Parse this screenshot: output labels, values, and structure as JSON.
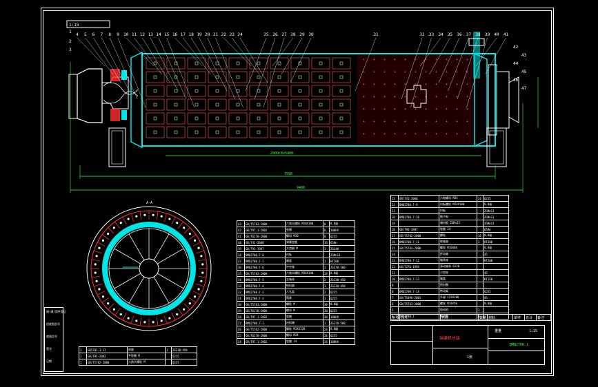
{
  "colors": {
    "background": "#000000",
    "line": "#ffffff",
    "shell": "#00e5e5",
    "hatch": "#ff3030",
    "dimension": "#40ff40",
    "leader": "#ffff40"
  },
  "icons": [
    "ball-mill-section-drawing",
    "end-view-cross-section"
  ],
  "title_box_label": "1:15",
  "view_label": "A-A",
  "balloon_numbers": [
    "1",
    "2",
    "3",
    "4",
    "5",
    "6",
    "7",
    "8",
    "9",
    "10",
    "11",
    "12",
    "13",
    "14",
    "15",
    "16",
    "17",
    "18",
    "19",
    "20",
    "21",
    "22",
    "23",
    "24",
    "25",
    "26",
    "27",
    "28",
    "29",
    "30",
    "31",
    "32",
    "33",
    "34",
    "35",
    "36",
    "37",
    "38",
    "39",
    "40",
    "41",
    "42",
    "43",
    "44",
    "45",
    "46",
    "47"
  ],
  "dimensions": {
    "overall": "9400",
    "span": "7590",
    "barrel": "2900/8x5400"
  },
  "parts_list_left": [
    {
      "no": "43",
      "code": "GB/T5783-2000",
      "name": "六角头螺栓 M20X180",
      "qty": "8",
      "mat": "8.8级"
    },
    {
      "no": "42",
      "code": "GB/T97.1-2002",
      "name": "垫圈",
      "qty": "8",
      "mat": "300HV"
    },
    {
      "no": "41",
      "code": "GB/T6170-2000",
      "name": "螺母 M20",
      "qty": "8",
      "mat": "Q235"
    },
    {
      "no": "40",
      "code": "GB/T41-2000",
      "name": "弹簧垫圈",
      "qty": "16",
      "mat": "65Mn"
    },
    {
      "no": "39",
      "code": "GB/T93-1987",
      "name": "大齿圈 M",
      "qty": "1",
      "mat": "ZG340"
    },
    {
      "no": "38",
      "code": "BMQ2700.7-8",
      "name": "衬板",
      "qty": "",
      "mat": "ZGMn13"
    },
    {
      "no": "37",
      "code": "BMQ2700.7-7",
      "name": "端盖",
      "qty": "1",
      "mat": "HT200"
    },
    {
      "no": "36",
      "code": "BMQ2700.7-6",
      "name": "中空轴",
      "qty": "1",
      "mat": "ZG270-500"
    },
    {
      "no": "35",
      "code": "GB/T5782-2000",
      "name": "六角头螺栓 M24X140",
      "qty": "24",
      "mat": "8.8级"
    },
    {
      "no": "34",
      "code": "BMQ2700.7-5",
      "name": "主轴承",
      "qty": "2",
      "mat": "ZG230-450"
    },
    {
      "no": "33",
      "code": "BMQ2700.7-4",
      "name": "给料器",
      "qty": "1",
      "mat": "ZG230-450"
    },
    {
      "no": "32",
      "code": "BMQ2700.7-3",
      "name": "人孔盖",
      "qty": "2",
      "mat": "Q235"
    },
    {
      "no": "31",
      "code": "BMQ2700.7-2",
      "name": "筒体",
      "qty": "1",
      "mat": "Q235"
    },
    {
      "no": "30",
      "code": "GB/T5783-2000",
      "name": "螺栓 M",
      "qty": "30",
      "mat": "8.8级"
    },
    {
      "no": "29",
      "code": "GB/T6170-2000",
      "name": "螺母 M",
      "qty": "30",
      "mat": "Q235"
    },
    {
      "no": "28",
      "code": "GB/T97.1-2002",
      "name": "垫圈",
      "qty": "30",
      "mat": "300HV"
    },
    {
      "no": "27",
      "code": "BMQ2700.7-1",
      "name": "出料端",
      "qty": "1",
      "mat": "ZG270-500"
    },
    {
      "no": "26",
      "code": "GB/T5782-2000",
      "name": "螺栓 M24X120",
      "qty": "24",
      "mat": "8.8级"
    },
    {
      "no": "25",
      "code": "GB/T6170-2000",
      "name": "螺母 M24",
      "qty": "24",
      "mat": "Q235"
    },
    {
      "no": "24",
      "code": "GB/T97.1-2002",
      "name": "垫圈 24",
      "qty": "24",
      "mat": "300HV"
    }
  ],
  "parts_list_right": [
    {
      "no": "23",
      "code": "GB/T41-2000",
      "name": "六角螺母 M24",
      "qty": "24",
      "mat": "Q235"
    },
    {
      "no": "22",
      "code": "BMQ2700.7-9",
      "name": "衬板螺栓 M24X100",
      "qty": "",
      "mat": "8.8级"
    },
    {
      "no": "21",
      "code": "",
      "name": "衬板",
      "qty": "",
      "mat": "ZGMn13"
    },
    {
      "no": "20",
      "code": "BMQ2700.7-10",
      "name": "格子板",
      "qty": "",
      "mat": "ZGMn13"
    },
    {
      "no": "19",
      "code": "",
      "name": "端衬板 ZGMn13",
      "qty": "",
      "mat": "ZGMn13"
    },
    {
      "no": "18",
      "code": "GB/T93-1987",
      "name": "垫圈 24",
      "qty": "",
      "mat": "65Mn"
    },
    {
      "no": "17",
      "code": "GB/T5782-2000",
      "name": "螺栓",
      "qty": "16",
      "mat": "8.8级"
    },
    {
      "no": "16",
      "code": "BMQ2700.7-11",
      "name": "联轴器",
      "qty": "1",
      "mat": "HT200"
    },
    {
      "no": "15",
      "code": "GB/T5783-2000",
      "name": "螺栓 M16X60",
      "qty": "",
      "mat": "8.8级"
    },
    {
      "no": "14",
      "code": "",
      "name": "传动轴",
      "qty": "",
      "mat": "45"
    },
    {
      "no": "13",
      "code": "BMQ2700.7-12",
      "name": "轴承座",
      "qty": "",
      "mat": "HT200"
    },
    {
      "no": "12",
      "code": "GB/T276-1994",
      "name": "滚动轴承 6220",
      "qty": "",
      "mat": ""
    },
    {
      "no": "11",
      "code": "",
      "name": "小齿轮",
      "qty": "",
      "mat": "45"
    },
    {
      "no": "10",
      "code": "BMQ2700.7-13",
      "name": "端盖",
      "qty": "",
      "mat": "HT150"
    },
    {
      "no": "9",
      "code": "",
      "name": "密封圈",
      "qty": "",
      "mat": ""
    },
    {
      "no": "8",
      "code": "BMQ2700.7-14",
      "name": "传动架",
      "qty": "",
      "mat": "Q235"
    },
    {
      "no": "7",
      "code": "GB/T1096-2003",
      "name": "平键 C22X100",
      "qty": "",
      "mat": "45"
    },
    {
      "no": "6",
      "code": "GB/T5783-2000",
      "name": "螺栓 M16X50",
      "qty": "",
      "mat": "8.8级"
    },
    {
      "no": "5",
      "code": "",
      "name": "电动机",
      "qty": "1",
      "mat": ""
    },
    {
      "no": "4",
      "code": "BMQ2700.1",
      "name": "减速器",
      "qty": "1",
      "mat": ""
    }
  ],
  "parts_list_bottom": [
    {
      "no": "3",
      "code": "GB5782.1-17",
      "name": "底座",
      "qty": "1",
      "mat": "ZG230-450"
    },
    {
      "no": "2",
      "code": "GB/T95-2002",
      "name": "平垫圈 M",
      "qty": "",
      "mat": "Q235"
    },
    {
      "no": "1",
      "code": "GB/T5782-2000",
      "name": "六角头螺栓 M",
      "qty": "",
      "mat": "Q235"
    }
  ],
  "title_block": {
    "headers": [
      "序号",
      "代号",
      "名称",
      "数量",
      "材料",
      "单件",
      "总计",
      "备注"
    ],
    "weight_label": "重量",
    "drawing_title": "球磨机总装",
    "drawing_no": "BMQ2700.1",
    "scale": "1:15",
    "sheet": "1张"
  },
  "left_stamp": [
    "借(通)用件登记",
    "旧底图总号",
    "底图总号",
    "签字",
    "日期"
  ]
}
